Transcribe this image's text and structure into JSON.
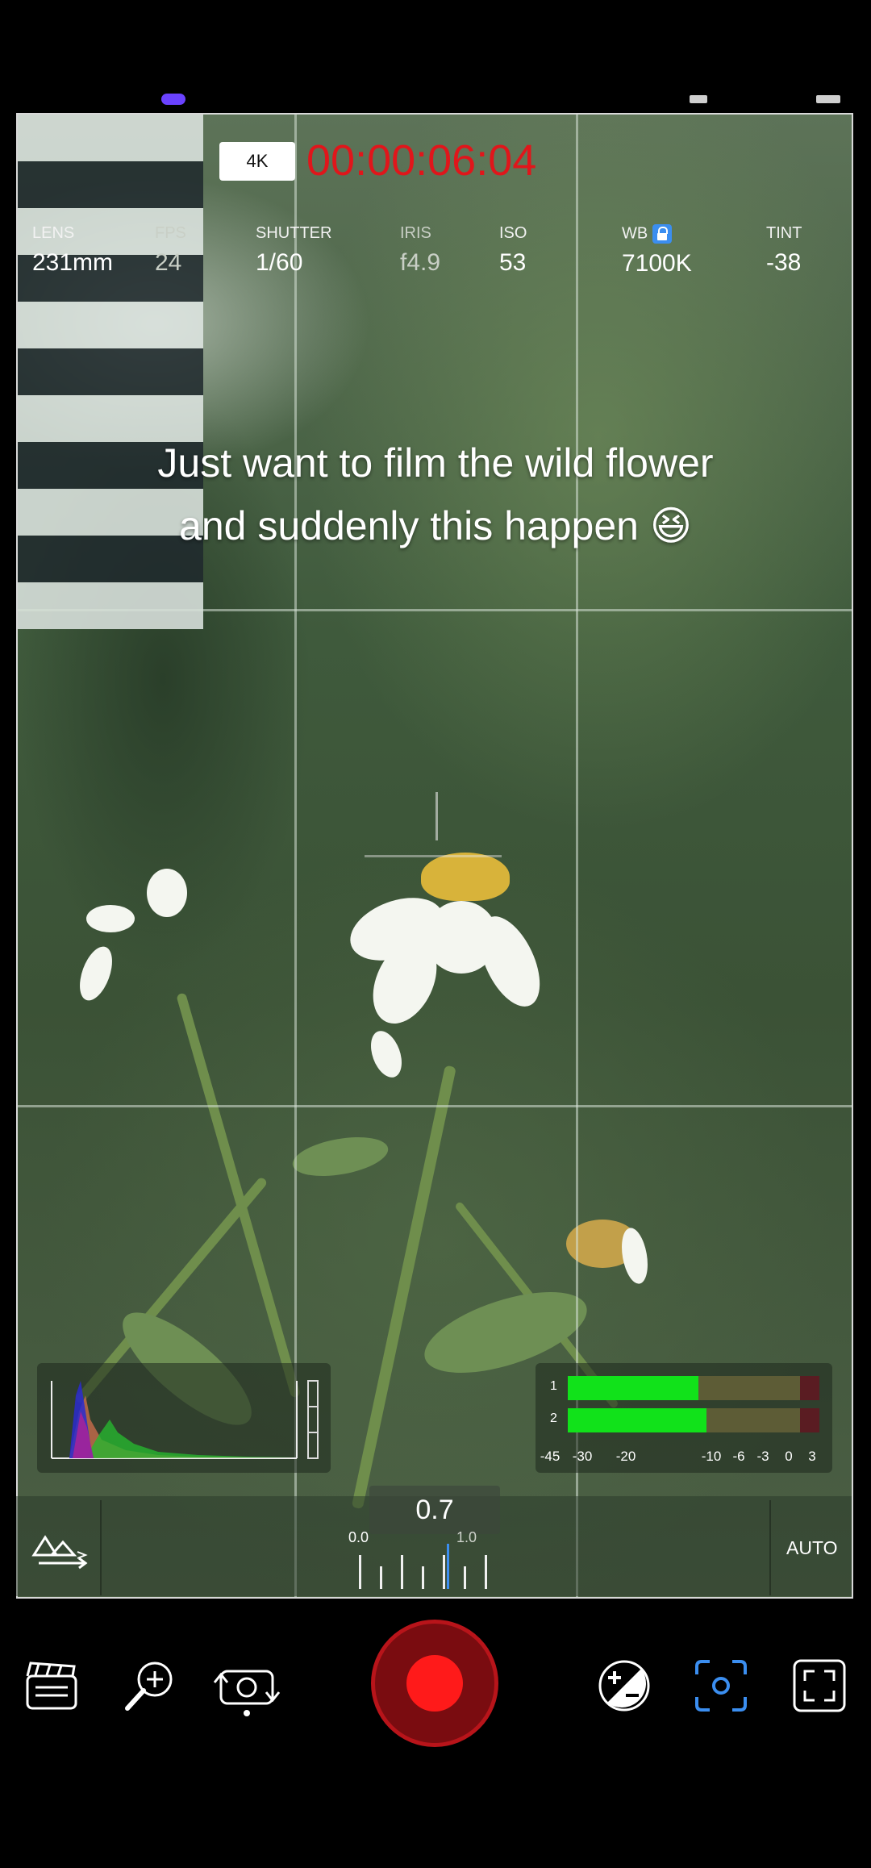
{
  "status_bar": {
    "left_text": "",
    "right_text": ""
  },
  "hud": {
    "resolution": "4K",
    "timecode": "00:00:06:04",
    "params": [
      {
        "label": "LENS",
        "value": "231mm"
      },
      {
        "label": "FPS",
        "value": "24"
      },
      {
        "label": "SHUTTER",
        "value": "1/60"
      },
      {
        "label": "IRIS",
        "value": "f4.9"
      },
      {
        "label": "ISO",
        "value": "53"
      },
      {
        "label": "WB",
        "value": "7100K"
      },
      {
        "label": "TINT",
        "value": "-38"
      }
    ]
  },
  "caption": {
    "line1": "Just want to film the wild flower",
    "line2": "and suddenly  this happen",
    "emoji": "😆"
  },
  "audio_meter": {
    "channels": [
      {
        "label": "1",
        "level_fraction": 0.52
      },
      {
        "label": "2",
        "level_fraction": 0.55
      }
    ],
    "scale": [
      "-45",
      "-30",
      "-20",
      "-10",
      "-6",
      "-3",
      "0",
      "3"
    ]
  },
  "focus_control": {
    "value": "0.7",
    "min_label": "0.0",
    "max_label": "1.0",
    "mode_label": "AUTO"
  },
  "toolbar": {
    "icons": [
      "clapperboard-icon",
      "zoom-in-icon",
      "camera-switch-icon",
      "record-button",
      "exposure-icon",
      "focus-target-icon",
      "fullscreen-icon"
    ]
  },
  "colors": {
    "timecode": "#e0161b",
    "record": "#ff1a1a",
    "accent": "#3b8ef0",
    "meter_green": "#11e21a"
  }
}
